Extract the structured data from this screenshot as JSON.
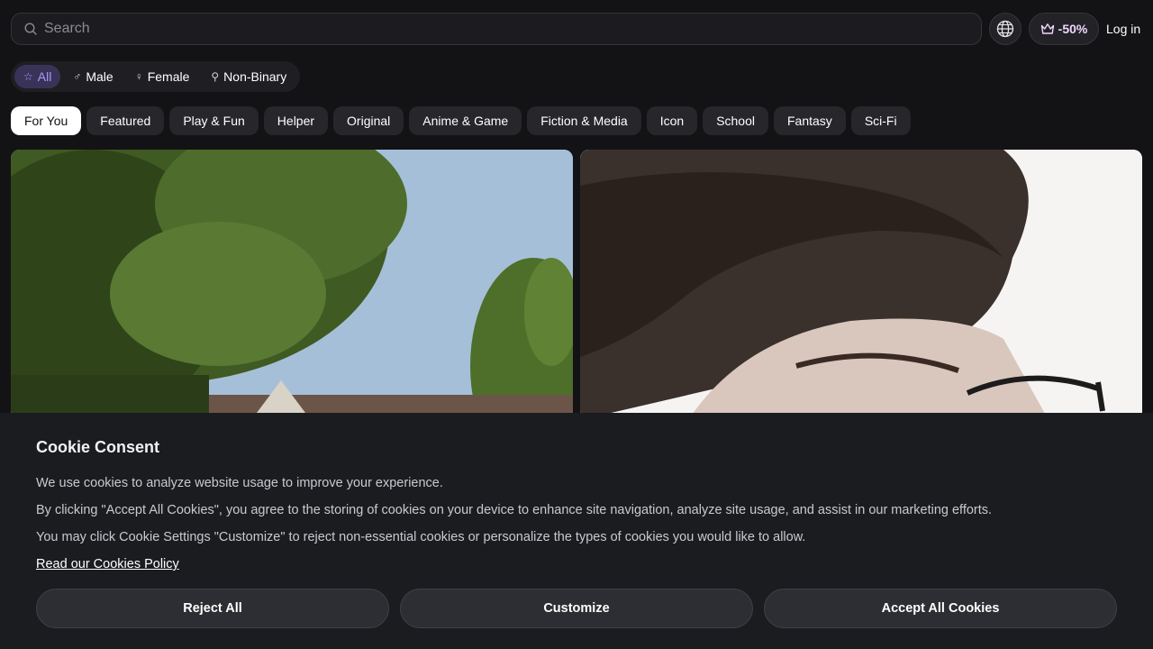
{
  "header": {
    "search_placeholder": "Search",
    "promo_label": "-50%",
    "login_label": "Log in"
  },
  "gender_tabs": [
    {
      "label": "All",
      "icon": "star-icon",
      "active": true
    },
    {
      "label": "Male",
      "icon": "male-symbol-icon",
      "active": false
    },
    {
      "label": "Female",
      "icon": "female-symbol-icon",
      "active": false
    },
    {
      "label": "Non-Binary",
      "icon": "non-binary-symbol-icon",
      "active": false
    }
  ],
  "categories": [
    "For You",
    "Featured",
    "Play & Fun",
    "Helper",
    "Original",
    "Anime & Game",
    "Fiction & Media",
    "Icon",
    "School",
    "Fantasy",
    "Sci-Fi"
  ],
  "active_category": "For You",
  "cookie": {
    "title": "Cookie Consent",
    "line1": "We use cookies to analyze website usage to improve your experience.",
    "line2": "By clicking \"Accept All Cookies\", you agree to the storing of cookies on your device to enhance site navigation, analyze site usage, and assist in our marketing efforts.",
    "line3": "You may click Cookie Settings \"Customize\" to reject non-essential cookies or personalize the types of cookies you would like to allow.",
    "policy_link": "Read our Cookies Policy",
    "reject_label": "Reject All",
    "customize_label": "Customize",
    "accept_label": "Accept All Cookies"
  },
  "colors": {
    "background": "#131316",
    "active_gender_bg": "#3a3358",
    "active_gender_text": "#a999ff",
    "promo_text": "#f0d6ff"
  }
}
